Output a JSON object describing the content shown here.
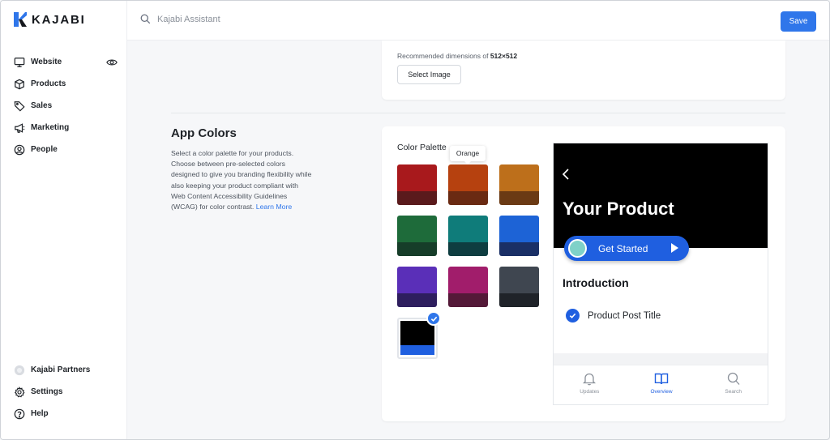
{
  "brand": {
    "name": "KAJABI"
  },
  "search": {
    "placeholder": "Kajabi Assistant"
  },
  "toolbar": {
    "save_label": "Save"
  },
  "sidebar": {
    "items": [
      {
        "label": "Website",
        "icon": "monitor-icon"
      },
      {
        "label": "Products",
        "icon": "box-icon"
      },
      {
        "label": "Sales",
        "icon": "tag-icon"
      },
      {
        "label": "Marketing",
        "icon": "megaphone-icon"
      },
      {
        "label": "People",
        "icon": "user-circle-icon"
      }
    ],
    "bottom": [
      {
        "label": "Kajabi Partners",
        "icon": "partners-icon"
      },
      {
        "label": "Settings",
        "icon": "gear-icon"
      },
      {
        "label": "Help",
        "icon": "help-icon"
      }
    ]
  },
  "image_card": {
    "recommended_prefix": "Recommended dimensions of ",
    "recommended_value": "512×512",
    "select_label": "Select Image"
  },
  "app_colors": {
    "title": "App Colors",
    "description": "Select a color palette for your products. Choose between pre-selected colors designed to give you branding flexibility while also keeping your product compliant with Web Content Accessibility Guidelines (WCAG) for color contrast.",
    "learn_more": "Learn More",
    "palette_label": "Color Palette",
    "tooltip": "Orange",
    "swatches": [
      {
        "name": "Red",
        "top": "#a8191c",
        "bottom": "#5a1a1c"
      },
      {
        "name": "Orange",
        "top": "#b6410f",
        "bottom": "#6a2a12"
      },
      {
        "name": "Amber",
        "top": "#bd6f1b",
        "bottom": "#6b3a14"
      },
      {
        "name": "Green",
        "top": "#1e6b3a",
        "bottom": "#163d29"
      },
      {
        "name": "Teal",
        "top": "#0f7c7a",
        "bottom": "#0e3d40"
      },
      {
        "name": "Blue",
        "top": "#1d63d6",
        "bottom": "#1a2f66"
      },
      {
        "name": "Purple",
        "top": "#5a2fb8",
        "bottom": "#2e1e5e"
      },
      {
        "name": "Magenta",
        "top": "#a11d6b",
        "bottom": "#541938"
      },
      {
        "name": "Slate",
        "top": "#3f4650",
        "bottom": "#1f2329"
      },
      {
        "name": "Black",
        "top": "#000000",
        "bottom": "#1f5fe0",
        "selected": true
      }
    ]
  },
  "preview": {
    "title": "Your Product",
    "cta": "Get Started",
    "section": "Introduction",
    "post": "Product Post Title",
    "tabs": [
      {
        "label": "Updates",
        "icon": "bell-icon"
      },
      {
        "label": "Overview",
        "icon": "book-icon",
        "active": true
      },
      {
        "label": "Search",
        "icon": "search-icon"
      }
    ]
  }
}
